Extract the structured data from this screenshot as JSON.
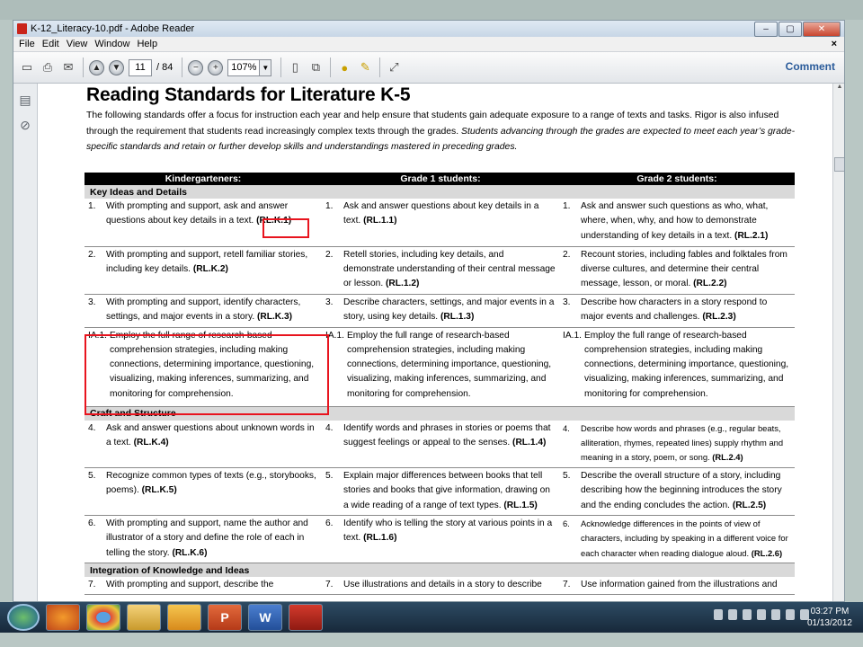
{
  "window": {
    "title": "K-12_Literacy-10.pdf - Adobe Reader",
    "btn_min": "–",
    "btn_max": "▢",
    "btn_close": "✕"
  },
  "menu": [
    "File",
    "Edit",
    "View",
    "Window",
    "Help"
  ],
  "menu_close": "×",
  "toolbar": {
    "page_current": "11",
    "page_total": "/ 84",
    "zoom": "107%",
    "comment_label": "Comment"
  },
  "doc": {
    "heading": "Reading Standards for Literature K-5",
    "intro_plain": "The following standards offer a focus for instruction each year and help ensure that students gain adequate exposure to a range of texts and tasks. Rigor is also infused through the requirement that students read increasingly complex texts through the grades. ",
    "intro_italic": "Students advancing through the grades are expected to meet each year’s grade-specific standards and retain or further develop skills and understandings mastered in preceding grades.",
    "columns": [
      "Kindergarteners:",
      "Grade 1 students:",
      "Grade 2 students:"
    ],
    "sections": {
      "s1": "Key Ideas and Details",
      "s2": "Craft and Structure",
      "s3": "Integration of Knowledge and Ideas"
    },
    "r1": {
      "k_num": "1.",
      "k_text": "With prompting and support, ask and answer questions about key details in a text.",
      "k_code": "(RL.K.1)",
      "g1_num": "1.",
      "g1_text": "Ask and answer questions about key details in a text.",
      "g1_code": "(RL.1.1)",
      "g2_num": "1.",
      "g2_text": "Ask and answer such questions as who, what, where, when, why, and how to demonstrate understanding of key details in a text.",
      "g2_code": "(RL.2.1)"
    },
    "r2": {
      "k_num": "2.",
      "k_text": "With prompting and support, retell familiar stories, including key details.",
      "k_code": "(RL.K.2)",
      "g1_num": "2.",
      "g1_text": "Retell stories, including key details, and demonstrate understanding of their central message or lesson.",
      "g1_code": "(RL.1.2)",
      "g2_num": "2.",
      "g2_text": "Recount stories, including fables and folktales from diverse cultures, and determine their central message, lesson, or moral.",
      "g2_code": "(RL.2.2)"
    },
    "r3": {
      "k_num": "3.",
      "k_text": "With prompting and support, identify characters, settings, and major events in a story.",
      "k_code": "(RL.K.3)",
      "g1_num": "3.",
      "g1_text": "Describe characters, settings, and major events in a story, using key details.",
      "g1_code": "(RL.1.3)",
      "g2_num": "3.",
      "g2_text": "Describe how characters in a story respond to major events and challenges.",
      "g2_code": "(RL.2.3)"
    },
    "r4": {
      "k_num": "IA.1.",
      "k_text": "Employ the full range of research-based comprehension strategies, including making connections, determining importance, questioning, visualizing, making inferences, summarizing, and monitoring for comprehension.",
      "g1_num": "IA.1.",
      "g1_text": "Employ the full range of research-based comprehension strategies, including making connections, determining importance, questioning, visualizing, making inferences, summarizing, and monitoring for comprehension.",
      "g2_num": "IA.1.",
      "g2_text": "Employ the full range of research-based comprehension strategies, including making connections, determining importance, questioning, visualizing, making inferences, summarizing, and monitoring for comprehension."
    },
    "r5": {
      "k_num": "4.",
      "k_text": "Ask and answer questions about unknown words in a text.",
      "k_code": "(RL.K.4)",
      "g1_num": "4.",
      "g1_text": "Identify words and phrases in stories or poems that suggest feelings or appeal to the senses.",
      "g1_code": "(RL.1.4)",
      "g2_num": "4.",
      "g2_text": "Describe how words and phrases (e.g., regular beats, alliteration, rhymes, repeated lines) supply rhythm and meaning in a story, poem, or song.",
      "g2_code": "(RL.2.4)"
    },
    "r6": {
      "k_num": "5.",
      "k_text": "Recognize common types of texts (e.g., storybooks, poems).",
      "k_code": "(RL.K.5)",
      "g1_num": "5.",
      "g1_text": "Explain major differences between books that tell stories and books that give information, drawing on a wide reading of a range of text types.",
      "g1_code": "(RL.1.5)",
      "g2_num": "5.",
      "g2_text": "Describe the overall structure of a story, including describing how the beginning introduces the story and the ending concludes the action.",
      "g2_code": "(RL.2.5)"
    },
    "r7": {
      "k_num": "6.",
      "k_text": "With prompting and support, name the author and illustrator of a story and define the role of each in telling the story.",
      "k_code": "(RL.K.6)",
      "g1_num": "6.",
      "g1_text": "Identify who is telling the story at various points in a text.",
      "g1_code": "(RL.1.6)",
      "g2_num": "6.",
      "g2_text": "Acknowledge differences in the points of view of characters, including by speaking in a different voice for each character when reading dialogue aloud.",
      "g2_code": "(RL.2.6)"
    },
    "r8": {
      "k_num": "7.",
      "k_text": "With prompting and support, describe the",
      "g1_num": "7.",
      "g1_text": "Use illustrations and details in a story to describe",
      "g2_num": "7.",
      "g2_text": "Use information gained from the illustrations and"
    }
  },
  "taskbar": {
    "apps": [
      "firefox-icon",
      "chrome-icon",
      "folder-icon",
      "outlook-icon",
      "powerpoint-icon",
      "word-icon",
      "adobe-reader-icon"
    ],
    "word_glyph": "W",
    "ppt_glyph": "P",
    "time": "03:27 PM",
    "date": "01/13/2012"
  },
  "colors": {
    "highlight": "#e8141e",
    "header_bg": "#000000",
    "section_bg": "#d9d9d9"
  }
}
